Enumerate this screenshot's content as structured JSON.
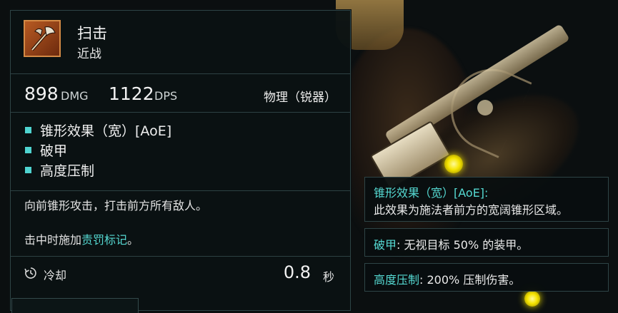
{
  "ability": {
    "name": "扫击",
    "category": "近战"
  },
  "stats": {
    "damage": "898",
    "damage_unit": "DMG",
    "dps": "1122",
    "dps_unit": "DPS",
    "damage_type": "物理（锐器）"
  },
  "keywords": [
    {
      "label": "锥形效果（宽）[AoE]"
    },
    {
      "label": "破甲"
    },
    {
      "label": "高度压制"
    }
  ],
  "description": {
    "line1": "向前锥形攻击，打击前方所有敌人。",
    "line2_prefix": "击中时施加",
    "line2_link": "责罚标记",
    "line2_suffix": "。"
  },
  "cooldown": {
    "label": "冷却",
    "value": "0.8",
    "unit": "秒"
  },
  "keyword_tooltips": [
    {
      "name": "锥形效果（宽）[AoE]:",
      "text": "此效果为施法者前方的宽阔锥形区域。"
    },
    {
      "name": "破甲",
      "text": ": 无视目标 50% 的装甲。"
    },
    {
      "name": "高度压制",
      "text": ": 200% 压制伤害。"
    }
  ],
  "colors": {
    "accent": "#55d9d2",
    "icon_bg": "#b75a22"
  },
  "icons": [
    "axe-ability-icon",
    "cooldown-icon"
  ]
}
